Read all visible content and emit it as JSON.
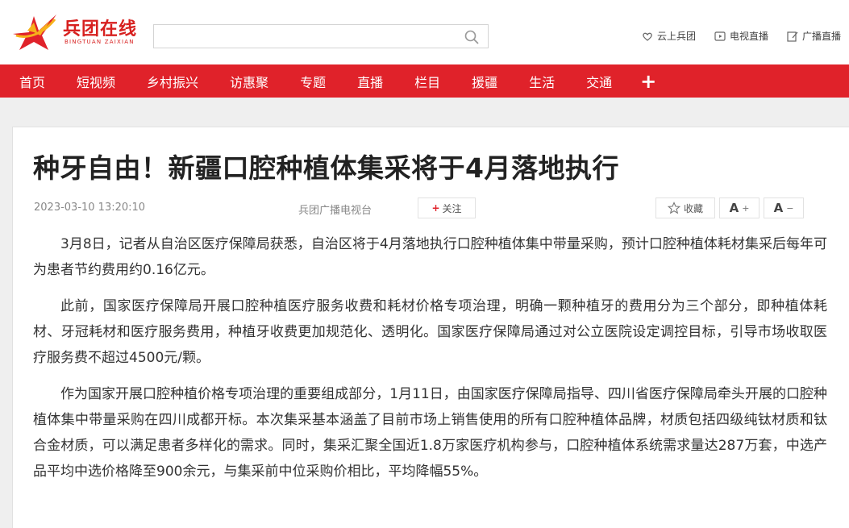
{
  "header": {
    "logo_text": "兵团在线",
    "logo_sub": "BINGTUAN ZAIXIAN",
    "search_placeholder": "",
    "links": [
      {
        "label": "云上兵团",
        "icon": "heart-hands-icon"
      },
      {
        "label": "电视直播",
        "icon": "tv-play-icon"
      },
      {
        "label": "广播直播",
        "icon": "edit-icon"
      }
    ]
  },
  "nav": {
    "items": [
      "首页",
      "短视频",
      "乡村振兴",
      "访惠聚",
      "专题",
      "直播",
      "栏目",
      "援疆",
      "生活",
      "交通"
    ],
    "more_label": "+"
  },
  "article": {
    "title": "种牙自由！新疆口腔种植体集采将于4月落地执行",
    "time": "2023-03-10 13:20:10",
    "source": "兵团广播电视台",
    "follow_label": "关注",
    "favorite_label": "收藏",
    "font_increase_label": "A",
    "font_decrease_label": "A",
    "paragraphs": [
      "3月8日，记者从自治区医疗保障局获悉，自治区将于4月落地执行口腔种植体集中带量采购，预计口腔种植体耗材集采后每年可为患者节约费用约0.16亿元。",
      "此前，国家医疗保障局开展口腔种植医疗服务收费和耗材价格专项治理，明确一颗种植牙的费用分为三个部分，即种植体耗材、牙冠耗材和医疗服务费用，种植牙收费更加规范化、透明化。国家医疗保障局通过对公立医院设定调控目标，引导市场收取医疗服务费不超过4500元/颗。",
      "作为国家开展口腔种植价格专项治理的重要组成部分，1月11日，由国家医疗保障局指导、四川省医疗保障局牵头开展的口腔种植体集中带量采购在四川成都开标。本次集采基本涵盖了目前市场上销售使用的所有口腔种植体品牌，材质包括四级纯钛材质和钛合金材质，可以满足患者多样化的需求。同时，集采汇聚全国近1.8万家医疗机构参与，口腔种植体系统需求量达287万套，中选产品平均中选价格降至900余元，与集采前中位采购价相比，平均降幅55%。"
    ]
  },
  "colors": {
    "brand_red": "#e0222a",
    "page_bg": "#efefef"
  }
}
